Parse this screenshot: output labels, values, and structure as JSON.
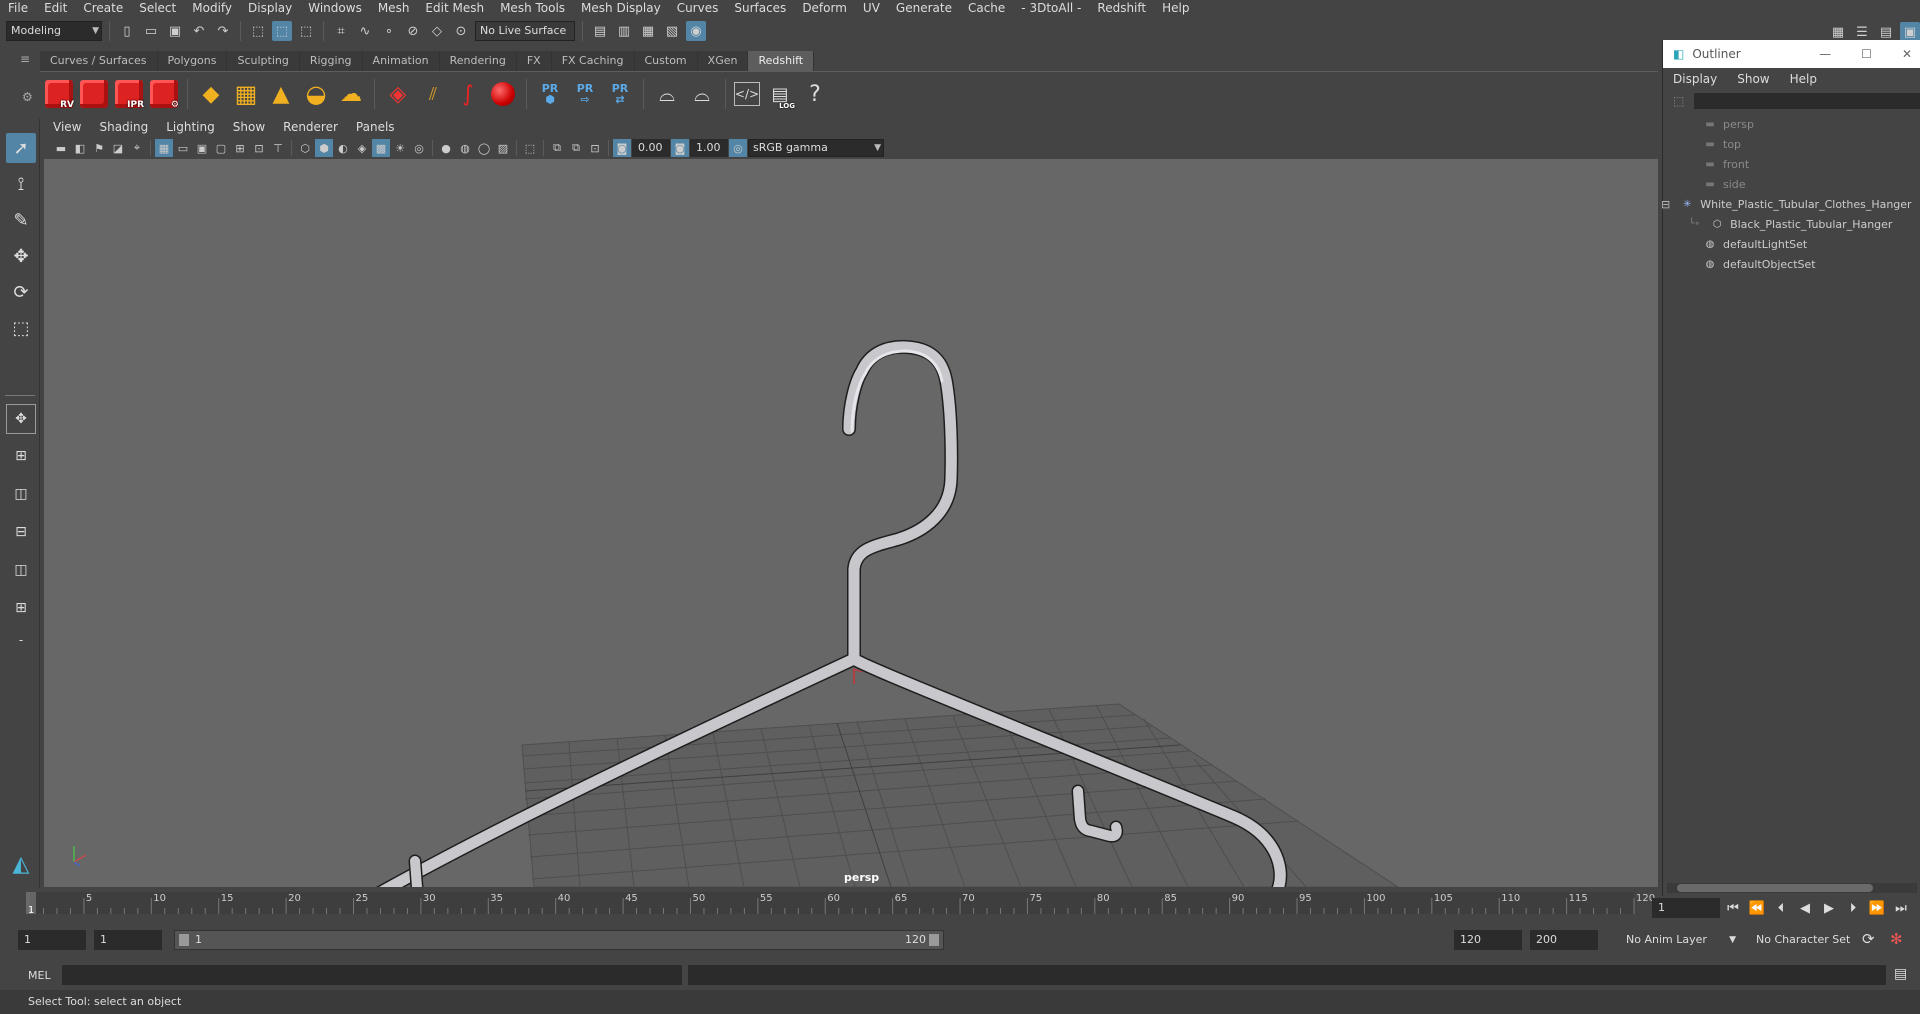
{
  "menubar": [
    "File",
    "Edit",
    "Create",
    "Select",
    "Modify",
    "Display",
    "Windows",
    "Mesh",
    "Edit Mesh",
    "Mesh Tools",
    "Mesh Display",
    "Curves",
    "Surfaces",
    "Deform",
    "UV",
    "Generate",
    "Cache",
    "- 3DtoAll -",
    "Redshift",
    "Help"
  ],
  "status": {
    "mode": "Modeling",
    "live_surface": "No Live Surface"
  },
  "shelf_tabs": [
    "Curves / Surfaces",
    "Polygons",
    "Sculpting",
    "Rigging",
    "Animation",
    "Rendering",
    "FX",
    "FX Caching",
    "Custom",
    "XGen",
    "Redshift"
  ],
  "shelf_active": "Redshift",
  "shelf_labels": {
    "rv": "RV",
    "ipr": "IPR",
    "pr": "PR",
    "log": "LOG",
    "help": "?"
  },
  "viewport_menu": [
    "View",
    "Shading",
    "Lighting",
    "Show",
    "Renderer",
    "Panels"
  ],
  "panel_toolbar": {
    "exposure": "0.00",
    "gamma": "1.00",
    "colorspace": "sRGB gamma"
  },
  "viewport": {
    "camera_label": "persp"
  },
  "outliner": {
    "title": "Outliner",
    "menu": [
      "Display",
      "Show",
      "Help"
    ],
    "items": [
      {
        "label": "persp",
        "dim": true,
        "icon": "camera-icon"
      },
      {
        "label": "top",
        "dim": true,
        "icon": "camera-icon"
      },
      {
        "label": "front",
        "dim": true,
        "icon": "camera-icon"
      },
      {
        "label": "side",
        "dim": true,
        "icon": "camera-icon"
      },
      {
        "label": "White_Plastic_Tubular_Clothes_Hanger",
        "dim": false,
        "icon": "group-icon"
      },
      {
        "label": "Black_Plastic_Tubular_Hanger",
        "dim": false,
        "icon": "mesh-icon"
      },
      {
        "label": "defaultLightSet",
        "dim": false,
        "icon": "set-icon"
      },
      {
        "label": "defaultObjectSet",
        "dim": false,
        "icon": "set-icon"
      }
    ]
  },
  "timeline": {
    "ticks": [
      "5",
      "10",
      "15",
      "20",
      "25",
      "30",
      "35",
      "40",
      "45",
      "50",
      "55",
      "60",
      "65",
      "70",
      "75",
      "80",
      "85",
      "90",
      "95",
      "100",
      "105",
      "110",
      "115",
      "120"
    ],
    "current_frame_marker": "1",
    "current_frame": "1"
  },
  "range": {
    "start": "1",
    "playback_start": "1",
    "slider_start": "1",
    "slider_end": "120",
    "playback_end": "120",
    "end": "200",
    "anim_layer": "No Anim Layer",
    "character_set": "No Character Set"
  },
  "command_line": {
    "lang": "MEL"
  },
  "help_line": "Select Tool: select an object",
  "colors": {
    "accent": "#5285a6",
    "viewport_bg": "#676767",
    "hanger": "#c8c8cc"
  }
}
